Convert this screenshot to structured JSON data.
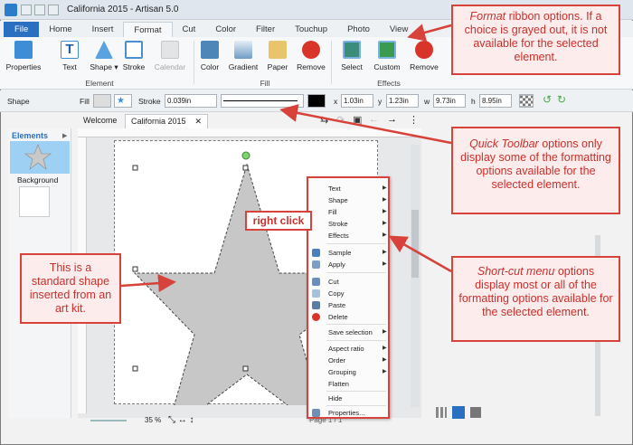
{
  "window": {
    "title": "California 2015 - Artisan 5.0"
  },
  "tabs": [
    "File",
    "Home",
    "Insert",
    "Format",
    "Cut",
    "Color",
    "Filter",
    "Touchup",
    "Photo",
    "View"
  ],
  "ribbon": {
    "element_group": "Element",
    "fill_group": "Fill",
    "effects_group": "Effects",
    "buttons": {
      "properties": "Properties",
      "text": "Text",
      "shape": "Shape",
      "stroke": "Stroke",
      "calendar": "Calendar",
      "color": "Color",
      "gradient": "Gradient",
      "paper": "Paper",
      "remove_fill": "Remove",
      "select": "Select",
      "custom": "Custom",
      "remove_effect": "Remove"
    }
  },
  "quick_toolbar": {
    "label": "Shape",
    "fill_label": "Fill",
    "stroke_label": "Stroke",
    "stroke_value": "0.039in",
    "x_label": "x",
    "x_value": "1.03in",
    "y_label": "y",
    "y_value": "1.23in",
    "w_label": "w",
    "w_value": "9.73in",
    "h_label": "h",
    "h_value": "8.95in"
  },
  "doc_tabs": [
    "Welcome",
    "California 2015"
  ],
  "elements_panel": {
    "title": "Elements",
    "background_label": "Background"
  },
  "context_menu": {
    "items": [
      "Text",
      "Shape",
      "Fill",
      "Stroke",
      "Effects",
      "Sample",
      "Apply",
      "Cut",
      "Copy",
      "Paste",
      "Delete",
      "Save selection",
      "Aspect ratio",
      "Order",
      "Grouping",
      "Flatten",
      "Hide",
      "Properties..."
    ]
  },
  "status": {
    "zoom": "35 %",
    "page": "Page 1 / 1"
  },
  "callouts": {
    "format_title": "Format",
    "format_body": "ribbon options. If a choice is grayed out, it is not available for the selected element.",
    "quick_title": "Quick Toolbar",
    "quick_body": "options only display some of the formatting options available for the selected element.",
    "shortcut_title": "Short-cut menu",
    "shortcut_body": "options display most or all of the formatting options available for the selected element.",
    "shape_body": "This is a standard shape inserted from an art kit.",
    "right_click": "right click"
  },
  "colors": {
    "accent": "#2b6fc0",
    "callout_border": "#d7423a",
    "callout_text": "#c9302c"
  }
}
